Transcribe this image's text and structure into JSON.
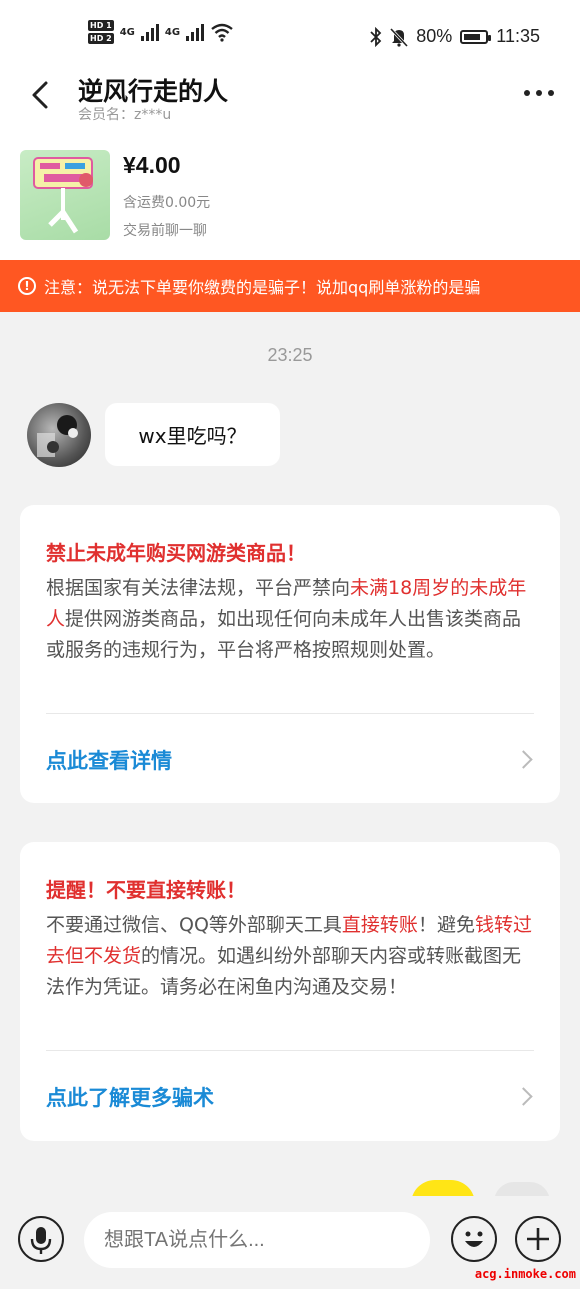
{
  "status_bar": {
    "hd1": "HD 1",
    "hd2": "HD 2",
    "net1": "4G",
    "net2": "4G",
    "battery": "80%",
    "battery_level": 0.8,
    "time": "11:35"
  },
  "header": {
    "title": "逆风行走的人",
    "subtitle": "会员名：z***u"
  },
  "product": {
    "price": "¥4.00",
    "shipping": "含运费0.00元",
    "chat_note": "交易前聊一聊"
  },
  "notice": {
    "text": "注意：说无法下单要你缴费的是骗子！说加qq刷单涨粉的是骗"
  },
  "chat": {
    "time": "23:25",
    "message": "wx里吃吗？"
  },
  "card1": {
    "title": "禁止未成年购买网游类商品！",
    "body_1": "根据国家有关法律法规，平台严禁向",
    "body_hl": "未满18周岁的未成年人",
    "body_2": "提供网游类商品，如出现任何向未成年人出售该类商品或服务的违规行为，平台将严格按照规则处置。",
    "link": "点此查看详情"
  },
  "card2": {
    "title": "提醒！不要直接转账！",
    "body_1": "不要通过微信、QQ等外部聊天工具",
    "body_hl1": "直接转账",
    "body_2": "！避免",
    "body_hl2": "钱转过去但不发货",
    "body_3": "的情况。如遇纠纷外部聊天内容或转账截图无法作为凭证。请务必在闲鱼内沟通及交易！",
    "link": "点此了解更多骗术"
  },
  "input": {
    "placeholder": "想跟TA说点什么..."
  },
  "watermark": "acg.inmoke.com"
}
